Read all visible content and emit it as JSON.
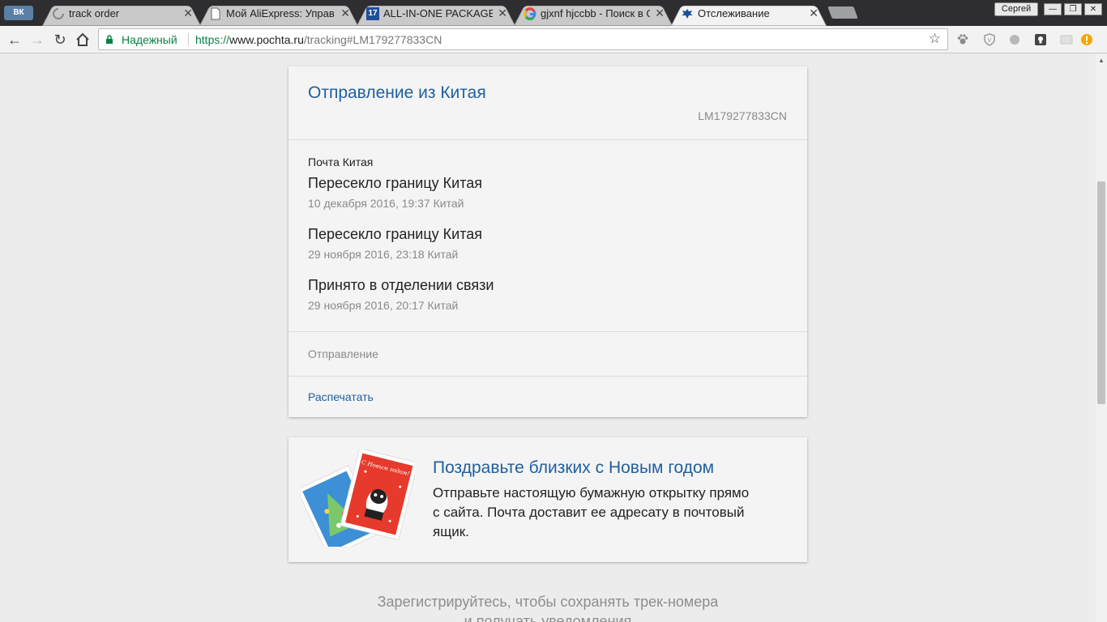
{
  "tabs": [
    {
      "title": "",
      "favicon": "vk-logo-icon"
    },
    {
      "title": "track order",
      "favicon": "loading-icon"
    },
    {
      "title": "Мой AliExpress: Управ",
      "favicon": "document-icon"
    },
    {
      "title": "ALL-IN-ONE PACKAGE T",
      "favicon": "17track-icon",
      "favicon_text": "17"
    },
    {
      "title": "gjxnf hjccbb - Поиск в G",
      "favicon": "google-icon"
    },
    {
      "title": "Отслеживание",
      "favicon": "pochta-eagle-icon",
      "active": true
    }
  ],
  "window": {
    "user": "Сергей"
  },
  "address_bar": {
    "security_label": "Надежный",
    "url_scheme": "https://",
    "url_host": "www.pochta.ru",
    "url_path": "/tracking#LM179277833CN"
  },
  "tracking": {
    "title": "Отправление из Китая",
    "track_number": "LM179277833CN",
    "operator": "Почта Китая",
    "events": [
      {
        "status": "Пересекло границу Китая",
        "meta": "10 декабря 2016, 19:37 Китай"
      },
      {
        "status": "Пересекло границу Китая",
        "meta": "29 ноября 2016, 23:18 Китай"
      },
      {
        "status": "Принято в отделении связи",
        "meta": "29 ноября 2016, 20:17 Китай"
      }
    ],
    "type_label": "Отправление",
    "print_label": "Распечатать"
  },
  "promo": {
    "title": "Поздравьте близких с Новым годом",
    "text": "Отправьте настоящую бумажную открытку прямо с сайта. Почта доставит ее адресату в почтовый ящик.",
    "card_text": "С Новым годом!"
  },
  "register": {
    "text_line1": "Зарегистрируйтесь, чтобы сохранять трек-номера",
    "text_line2": "и получать уведомления"
  },
  "colors": {
    "accent": "#1f5f9e",
    "secure_green": "#0b8043",
    "muted": "#8a8a8a"
  }
}
